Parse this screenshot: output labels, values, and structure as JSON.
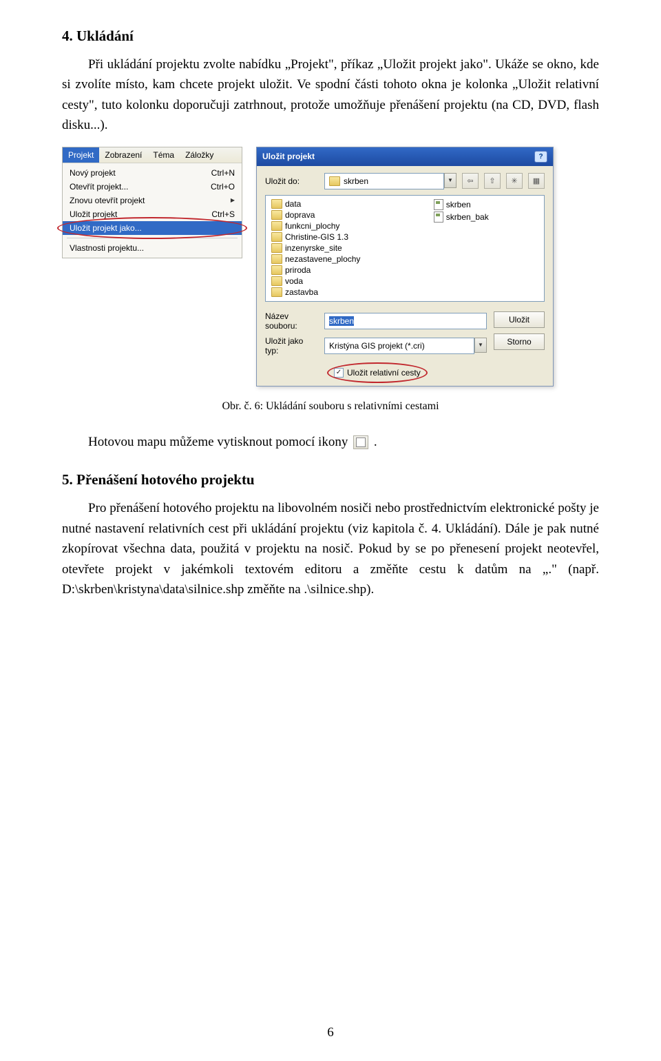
{
  "heading1": "4. Ukládání",
  "para1": "Při ukládání projektu zvolte nabídku „Projekt\", příkaz „Uložit projekt jako\". Ukáže se okno, kde si zvolíte místo, kam chcete projekt uložit. Ve spodní části tohoto okna je kolonka „Uložit relativní cesty\", tuto kolonku doporučuji zatrhnout, protože umožňuje přenášení projektu (na CD, DVD, flash disku...).",
  "menu": {
    "bar": [
      "Projekt",
      "Zobrazení",
      "Téma",
      "Záložky"
    ],
    "items": [
      {
        "label": "Nový projekt",
        "shortcut": "Ctrl+N"
      },
      {
        "label": "Otevřít projekt...",
        "shortcut": "Ctrl+O"
      },
      {
        "label": "Znovu otevřít projekt",
        "submenu": true
      },
      {
        "label": "Uložit projekt",
        "shortcut": "Ctrl+S"
      },
      {
        "label": "Uložit projekt jako...",
        "circled": true
      }
    ],
    "tail": "Vlastnosti projektu..."
  },
  "dialog": {
    "title": "Uložit projekt",
    "savein_label": "Uložit do:",
    "savein_value": "skrben",
    "files_folders": [
      "data",
      "doprava",
      "funkcni_plochy",
      "Christine-GIS 1.3",
      "inzenyrske_site",
      "nezastavene_plochy",
      "priroda",
      "voda",
      "zastavba"
    ],
    "files_docs": [
      "skrben",
      "skrben_bak"
    ],
    "name_label": "Název souboru:",
    "name_value": "skrben",
    "type_label": "Uložit jako typ:",
    "type_value": "Kristýna GIS projekt (*.cri)",
    "chk_label": "Uložit relativní cesty",
    "btn_save": "Uložit",
    "btn_cancel": "Storno"
  },
  "caption": "Obr. č. 6: Ukládání souboru s relativními cestami",
  "para2_pre": "Hotovou mapu můžeme vytisknout pomocí ikony ",
  "para2_post": " .",
  "heading2": "5. Přenášení hotového projektu",
  "para3": "Pro přenášení hotového projektu na libovolném nosiči nebo prostřednictvím elektronické pošty je nutné nastavení relativních cest při ukládání projektu (viz kapitola č. 4. Ukládání). Dále je pak nutné zkopírovat všechna data, použitá v projektu na nosič. Pokud by se po přenesení projekt neotevřel, otevřete projekt v jakémkoli textovém editoru a změňte cestu k datům na „.\" (např. D:\\skrben\\kristyna\\data\\silnice.shp změňte na .\\silnice.shp).",
  "page_number": "6"
}
